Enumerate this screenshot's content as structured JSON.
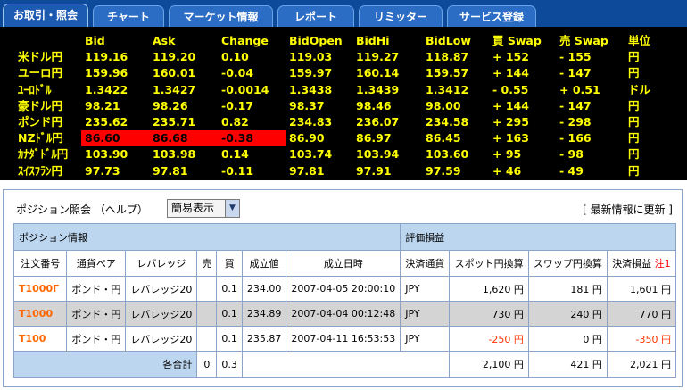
{
  "tabs": [
    "お取引・照会",
    "チャート",
    "マーケット情報",
    "レポート",
    "リミッター",
    "サービス登録"
  ],
  "quote_board": {
    "headers": [
      "Bid",
      "Ask",
      "Change",
      "BidOpen",
      "BidHi",
      "BidLow",
      "買 Swap",
      "売 Swap",
      "単位"
    ],
    "rows": [
      {
        "pair": "米ドル円",
        "values": [
          "119.16",
          "119.20",
          "0.10",
          "119.03",
          "119.27",
          "118.87",
          "+ 152",
          "- 155",
          "円"
        ]
      },
      {
        "pair": "ユーロ円",
        "values": [
          "159.96",
          "160.01",
          "-0.04",
          "159.97",
          "160.14",
          "159.57",
          "+ 144",
          "- 147",
          "円"
        ]
      },
      {
        "pair": "ﾕｰﾛﾄﾞﾙ",
        "values": [
          "1.3422",
          "1.3427",
          "-0.0014",
          "1.3438",
          "1.3439",
          "1.3412",
          "- 0.55",
          "+ 0.51",
          "ドル"
        ]
      },
      {
        "pair": "豪ドル円",
        "values": [
          "98.21",
          "98.26",
          "-0.17",
          "98.37",
          "98.46",
          "98.00",
          "+ 144",
          "- 147",
          "円"
        ]
      },
      {
        "pair": "ポンド円",
        "values": [
          "235.62",
          "235.71",
          "0.82",
          "234.83",
          "236.07",
          "234.58",
          "+ 295",
          "- 298",
          "円"
        ]
      },
      {
        "pair": "NZﾄﾞﾙ円",
        "values": [
          "86.60",
          "86.68",
          "-0.38",
          "86.90",
          "86.97",
          "86.45",
          "+ 163",
          "- 166",
          "円"
        ]
      },
      {
        "pair": "ｶﾅﾀﾞﾄﾞﾙ円",
        "values": [
          "103.90",
          "103.98",
          "0.14",
          "103.74",
          "103.94",
          "103.60",
          "+ 95",
          "- 98",
          "円"
        ]
      },
      {
        "pair": "ｽｲｽﾌﾗﾝ円",
        "values": [
          "97.73",
          "97.81",
          "-0.11",
          "97.81",
          "97.91",
          "97.59",
          "+ 46",
          "- 49",
          "円"
        ]
      }
    ],
    "highlight_color": "#ff0000",
    "text_color": "#ffff00"
  },
  "panel": {
    "title": "ポジション照会 （ヘルプ）",
    "select_value": "簡易表示",
    "refresh_label": "[ 最新情報に更新 ]",
    "section_left": "ポジション情報",
    "section_right": "評価損益",
    "columns": [
      "注文番号",
      "通貨ペア",
      "レバレッジ",
      "売",
      "買",
      "成立値",
      "成立日時",
      "決済通貨",
      "スポット円換算",
      "スワップ円換算",
      "決済損益",
      "注1"
    ],
    "rows": [
      {
        "order": "T1000Γ",
        "pair": "ポンド・円",
        "lev": "レバレッジ20",
        "sell": "",
        "buy": "0.1",
        "price": "234.00",
        "datetime": "2007-04-05 20:00:10",
        "ccy": "JPY",
        "spot": "1,620 円",
        "swap": "181 円",
        "pl": "1,601 円"
      },
      {
        "order": "T1000",
        "pair": "ポンド・円",
        "lev": "レバレッジ20",
        "sell": "",
        "buy": "0.1",
        "price": "234.89",
        "datetime": "2007-04-04 00:12:48",
        "ccy": "JPY",
        "spot": "730 円",
        "swap": "240 円",
        "pl": "770 円"
      },
      {
        "order": "T100",
        "pair": "ポンド・円",
        "lev": "レバレッジ20",
        "sell": "",
        "buy": "0.1",
        "price": "235.87",
        "datetime": "2007-04-11 16:53:53",
        "ccy": "JPY",
        "spot": "-250 円",
        "swap": "0 円",
        "pl": "-350 円"
      }
    ],
    "total": {
      "label": "各合計",
      "sell": "0",
      "buy": "0.3",
      "spot": "2,100 円",
      "swap": "421 円",
      "pl": "2,021 円"
    }
  }
}
